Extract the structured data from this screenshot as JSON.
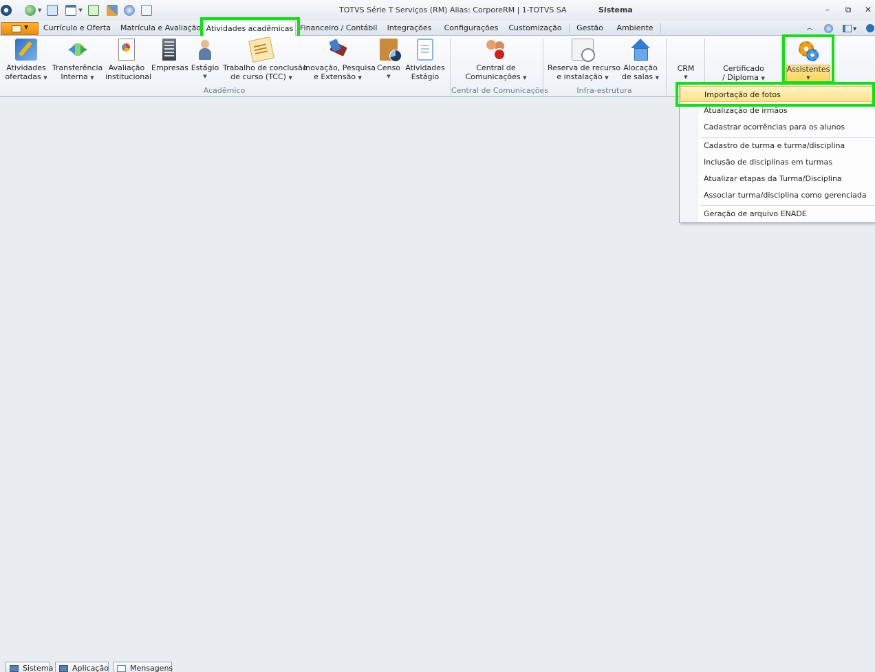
{
  "window": {
    "title": "TOTVS Série T Serviços (RM) Alias: CorporeRM | 1-TOTVS SA",
    "context": "Sistema"
  },
  "tabs": [
    {
      "label": "Currículo e Oferta"
    },
    {
      "label": "Matrícula e Avaliação"
    },
    {
      "label": "Atividades acadêmicas",
      "active": true
    },
    {
      "label": "Financeiro / Contábil"
    },
    {
      "label": "Integrações"
    },
    {
      "label": "Configurações"
    },
    {
      "label": "Customização"
    },
    {
      "label": "Gestão"
    },
    {
      "label": "Ambiente"
    }
  ],
  "ribbon": {
    "groups": {
      "academico": "Acadêmico",
      "comunicacoes": "Central de Comunicações",
      "infra": "Infra-estrutura"
    },
    "buttons": {
      "atividades_ofertadas": [
        "Atividades",
        "ofertadas"
      ],
      "transferencia_interna": [
        "Transferência",
        "Interna"
      ],
      "avaliacao_institucional": [
        "Avaliação",
        "institucional"
      ],
      "empresas": "Empresas",
      "estagio": "Estágio",
      "tcc": [
        "Trabalho de conclusão",
        "de curso (TCC)"
      ],
      "inovacao": [
        "Inovação, Pesquisa",
        "e Extensão"
      ],
      "censo": "Censo",
      "atividades_estagio": [
        "Atividades",
        "Estágio"
      ],
      "central_comunicacoes": [
        "Central de",
        "Comunicações"
      ],
      "reserva_recurso": [
        "Reserva de recurso",
        "e instalação"
      ],
      "alocacao_salas": [
        "Alocação",
        "de salas"
      ],
      "crm": "CRM",
      "certificado": [
        "Certificado",
        "/ Diploma"
      ],
      "assistentes": "Assistentes"
    }
  },
  "assistentes_menu": {
    "items": [
      "Importação de fotos",
      "Atualização de irmãos",
      "Cadastrar ocorrências para os alunos",
      "Cadastro de turma e turma/disciplina",
      "Inclusão de disciplinas em turmas",
      "Atualizar etapas da Turma/Disciplina",
      "Associar turma/disciplina como gerenciada",
      "Geração de arquivo ENADE"
    ],
    "highlighted_index": 0
  },
  "status_tabs": [
    "Sistema",
    "Aplicação",
    "Mensagens"
  ],
  "colors": {
    "highlight_box": "#0fe30f",
    "menu_highlight": "#ffe28a"
  }
}
